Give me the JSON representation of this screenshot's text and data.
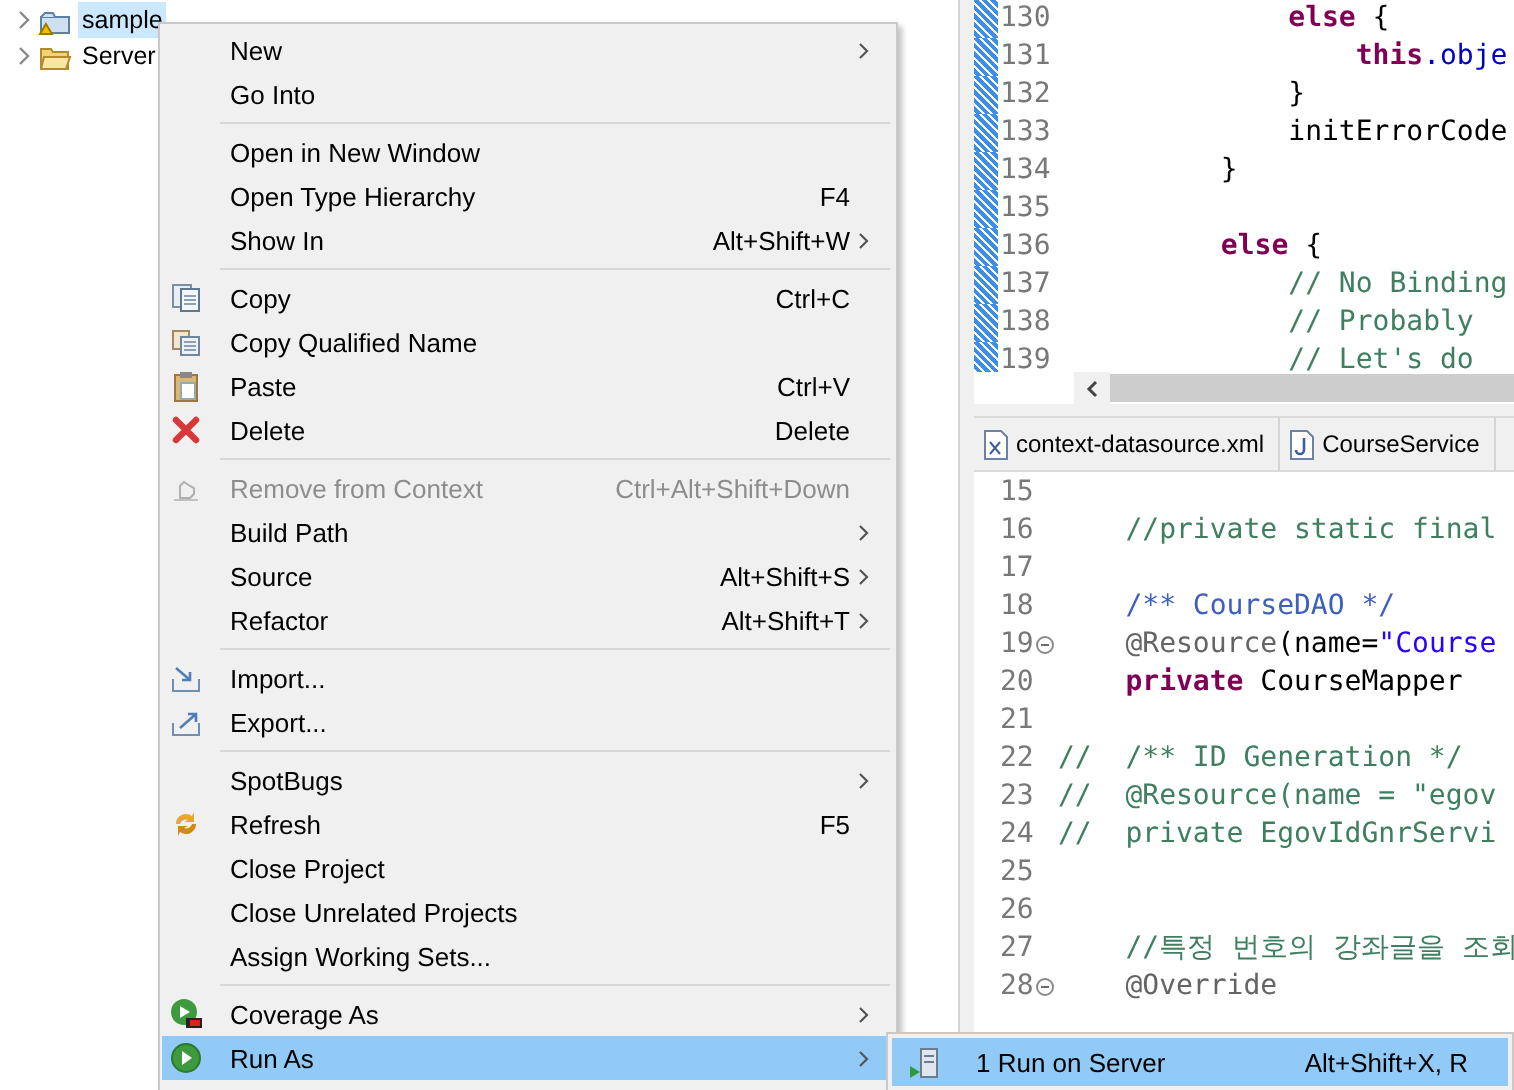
{
  "project_explorer": {
    "items": [
      {
        "label": "sample",
        "selected": true
      },
      {
        "label": "Server",
        "selected": false
      }
    ]
  },
  "editor_top": {
    "lines": [
      {
        "number": "130",
        "changed": true,
        "tokens": [
          {
            "text": "            else",
            "kind": "keyword"
          },
          {
            "text": " {",
            "kind": "plain"
          }
        ]
      },
      {
        "number": "131",
        "changed": true,
        "tokens": [
          {
            "text": "                this",
            "kind": "keyword"
          },
          {
            "text": ".obje",
            "kind": "field"
          }
        ]
      },
      {
        "number": "132",
        "changed": true,
        "tokens": [
          {
            "text": "            }",
            "kind": "plain"
          }
        ]
      },
      {
        "number": "133",
        "changed": true,
        "tokens": [
          {
            "text": "            initErrorCode",
            "kind": "plain"
          }
        ]
      },
      {
        "number": "134",
        "changed": true,
        "tokens": [
          {
            "text": "        }",
            "kind": "plain"
          }
        ]
      },
      {
        "number": "135",
        "changed": true
      },
      {
        "number": "136",
        "changed": true,
        "tokens": [
          {
            "text": "        else",
            "kind": "keyword"
          },
          {
            "text": " {",
            "kind": "plain"
          }
        ]
      },
      {
        "number": "137",
        "changed": true,
        "tokens": [
          {
            "text": "            // No Binding",
            "kind": "comment"
          }
        ]
      },
      {
        "number": "138",
        "changed": true,
        "tokens": [
          {
            "text": "            // Probably",
            "kind": "comment"
          }
        ]
      },
      {
        "number": "139",
        "changed": true,
        "tokens": [
          {
            "text": "            // Let's do",
            "kind": "comment"
          }
        ]
      }
    ]
  },
  "editor_tabs": [
    {
      "label": "context-datasource.xml"
    },
    {
      "label": "CourseService"
    }
  ],
  "editor_bottom": {
    "lines": [
      {
        "number": "15"
      },
      {
        "number": "16",
        "tokens": [
          {
            "text": "    //private static final",
            "kind": "comment"
          }
        ]
      },
      {
        "number": "17"
      },
      {
        "number": "18",
        "tokens": [
          {
            "text": "    /** CourseDAO */",
            "kind": "javadoc"
          }
        ]
      },
      {
        "number": "19",
        "fold_marker": true,
        "tokens": [
          {
            "text": "    @Resource",
            "kind": "annotation"
          },
          {
            "text": "(name=",
            "kind": "plain"
          },
          {
            "text": "\"Course",
            "kind": "string"
          }
        ]
      },
      {
        "number": "20",
        "tokens": [
          {
            "text": "    private",
            "kind": "keyword"
          },
          {
            "text": " CourseMapper",
            "kind": "plain"
          }
        ]
      },
      {
        "number": "21"
      },
      {
        "number": "22",
        "tokens": [
          {
            "text": "//  /** ID Generation */",
            "kind": "comment"
          }
        ]
      },
      {
        "number": "23",
        "tokens": [
          {
            "text": "//  @Resource(name = \"egov",
            "kind": "comment"
          }
        ]
      },
      {
        "number": "24",
        "tokens": [
          {
            "text": "//  private EgovIdGnrServi",
            "kind": "comment"
          }
        ]
      },
      {
        "number": "25"
      },
      {
        "number": "26"
      },
      {
        "number": "27",
        "tokens": [
          {
            "text": "    //특정 번호의 강좌글을 조회",
            "kind": "comment"
          }
        ]
      },
      {
        "number": "28",
        "fold_marker": true,
        "tokens": [
          {
            "text": "    @Override",
            "kind": "annotation"
          }
        ]
      }
    ]
  },
  "context_menu": {
    "items": [
      {
        "kind": "item",
        "label": "New",
        "submenu": true,
        "disabled": false,
        "selected": false
      },
      {
        "kind": "item",
        "label": "Go Into",
        "submenu": false,
        "disabled": false,
        "selected": false
      },
      {
        "kind": "separator"
      },
      {
        "kind": "item",
        "label": "Open in New Window",
        "submenu": false,
        "disabled": false,
        "selected": false
      },
      {
        "kind": "item",
        "label": "Open Type Hierarchy",
        "shortcut": "F4",
        "submenu": false,
        "disabled": false,
        "selected": false
      },
      {
        "kind": "item",
        "label": "Show In",
        "shortcut": "Alt+Shift+W",
        "submenu": true,
        "disabled": false,
        "selected": false
      },
      {
        "kind": "separator"
      },
      {
        "kind": "item",
        "label": "Copy",
        "shortcut": "Ctrl+C",
        "submenu": false,
        "disabled": false,
        "selected": false
      },
      {
        "kind": "item",
        "label": "Copy Qualified Name",
        "submenu": false,
        "disabled": false,
        "selected": false
      },
      {
        "kind": "item",
        "label": "Paste",
        "shortcut": "Ctrl+V",
        "submenu": false,
        "disabled": false,
        "selected": false
      },
      {
        "kind": "item",
        "label": "Delete",
        "shortcut": "Delete",
        "submenu": false,
        "disabled": false,
        "selected": false
      },
      {
        "kind": "separator"
      },
      {
        "kind": "item",
        "label": "Remove from Context",
        "shortcut": "Ctrl+Alt+Shift+Down",
        "submenu": false,
        "disabled": true,
        "selected": false
      },
      {
        "kind": "item",
        "label": "Build Path",
        "submenu": true,
        "disabled": false,
        "selected": false
      },
      {
        "kind": "item",
        "label": "Source",
        "shortcut": "Alt+Shift+S",
        "submenu": true,
        "disabled": false,
        "selected": false
      },
      {
        "kind": "item",
        "label": "Refactor",
        "shortcut": "Alt+Shift+T",
        "submenu": true,
        "disabled": false,
        "selected": false
      },
      {
        "kind": "separator"
      },
      {
        "kind": "item",
        "label": "Import...",
        "submenu": false,
        "disabled": false,
        "selected": false
      },
      {
        "kind": "item",
        "label": "Export...",
        "submenu": false,
        "disabled": false,
        "selected": false
      },
      {
        "kind": "separator"
      },
      {
        "kind": "item",
        "label": "SpotBugs",
        "submenu": true,
        "disabled": false,
        "selected": false
      },
      {
        "kind": "item",
        "label": "Refresh",
        "shortcut": "F5",
        "submenu": false,
        "disabled": false,
        "selected": false
      },
      {
        "kind": "item",
        "label": "Close Project",
        "submenu": false,
        "disabled": false,
        "selected": false
      },
      {
        "kind": "item",
        "label": "Close Unrelated Projects",
        "submenu": false,
        "disabled": false,
        "selected": false
      },
      {
        "kind": "item",
        "label": "Assign Working Sets...",
        "submenu": false,
        "disabled": false,
        "selected": false
      },
      {
        "kind": "separator"
      },
      {
        "kind": "item",
        "label": "Coverage As",
        "submenu": true,
        "disabled": false,
        "selected": false
      },
      {
        "kind": "item",
        "label": "Run As",
        "submenu": true,
        "disabled": false,
        "selected": true
      }
    ]
  },
  "submenu": {
    "items": [
      {
        "label": "1 Run on Server",
        "shortcut": "Alt+Shift+X, R",
        "selected": true
      }
    ]
  }
}
